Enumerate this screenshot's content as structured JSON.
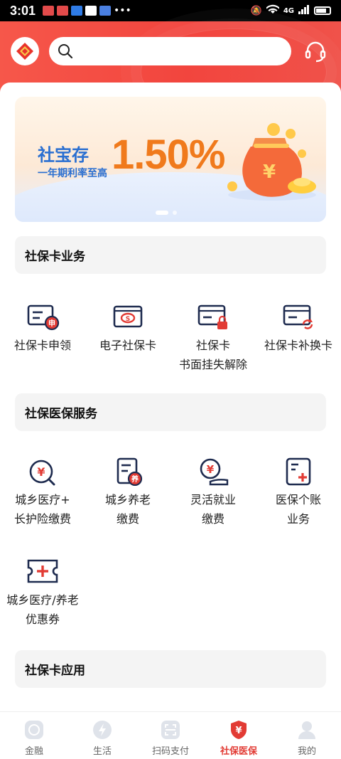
{
  "status_bar": {
    "time": "3:01",
    "network": "4G"
  },
  "header": {
    "search_placeholder": ""
  },
  "banner": {
    "title": "社宝存",
    "subtitle": "一年期利率至高",
    "rate": "1.50%"
  },
  "sections": {
    "card_business": {
      "title": "社保卡业务",
      "items": [
        {
          "label": "社保卡申领"
        },
        {
          "label": "电子社保卡"
        },
        {
          "label_line1": "社保卡",
          "label_line2": "书面挂失解除"
        },
        {
          "label": "社保卡补换卡"
        }
      ]
    },
    "medical_services": {
      "title": "社保医保服务",
      "items": [
        {
          "label_line1": "城乡医疗+",
          "label_line2": "长护险缴费"
        },
        {
          "label_line1": "城乡养老",
          "label_line2": "缴费"
        },
        {
          "label_line1": "灵活就业",
          "label_line2": "缴费"
        },
        {
          "label_line1": "医保个账",
          "label_line2": "业务"
        },
        {
          "label_line1": "城乡医疗/养老",
          "label_line2": "优惠券"
        }
      ]
    },
    "card_apps": {
      "title": "社保卡应用"
    }
  },
  "tabbar": {
    "items": [
      {
        "label": "金融"
      },
      {
        "label": "生活"
      },
      {
        "label": "扫码支付"
      },
      {
        "label": "社保医保"
      },
      {
        "label": "我的"
      }
    ],
    "active_index": 3
  },
  "colors": {
    "brand_red": "#f2453e",
    "accent_red": "#e23b34",
    "icon_navy": "#1e2b4f",
    "rate_orange": "#f07a1c",
    "banner_blue": "#2a6fd1"
  }
}
